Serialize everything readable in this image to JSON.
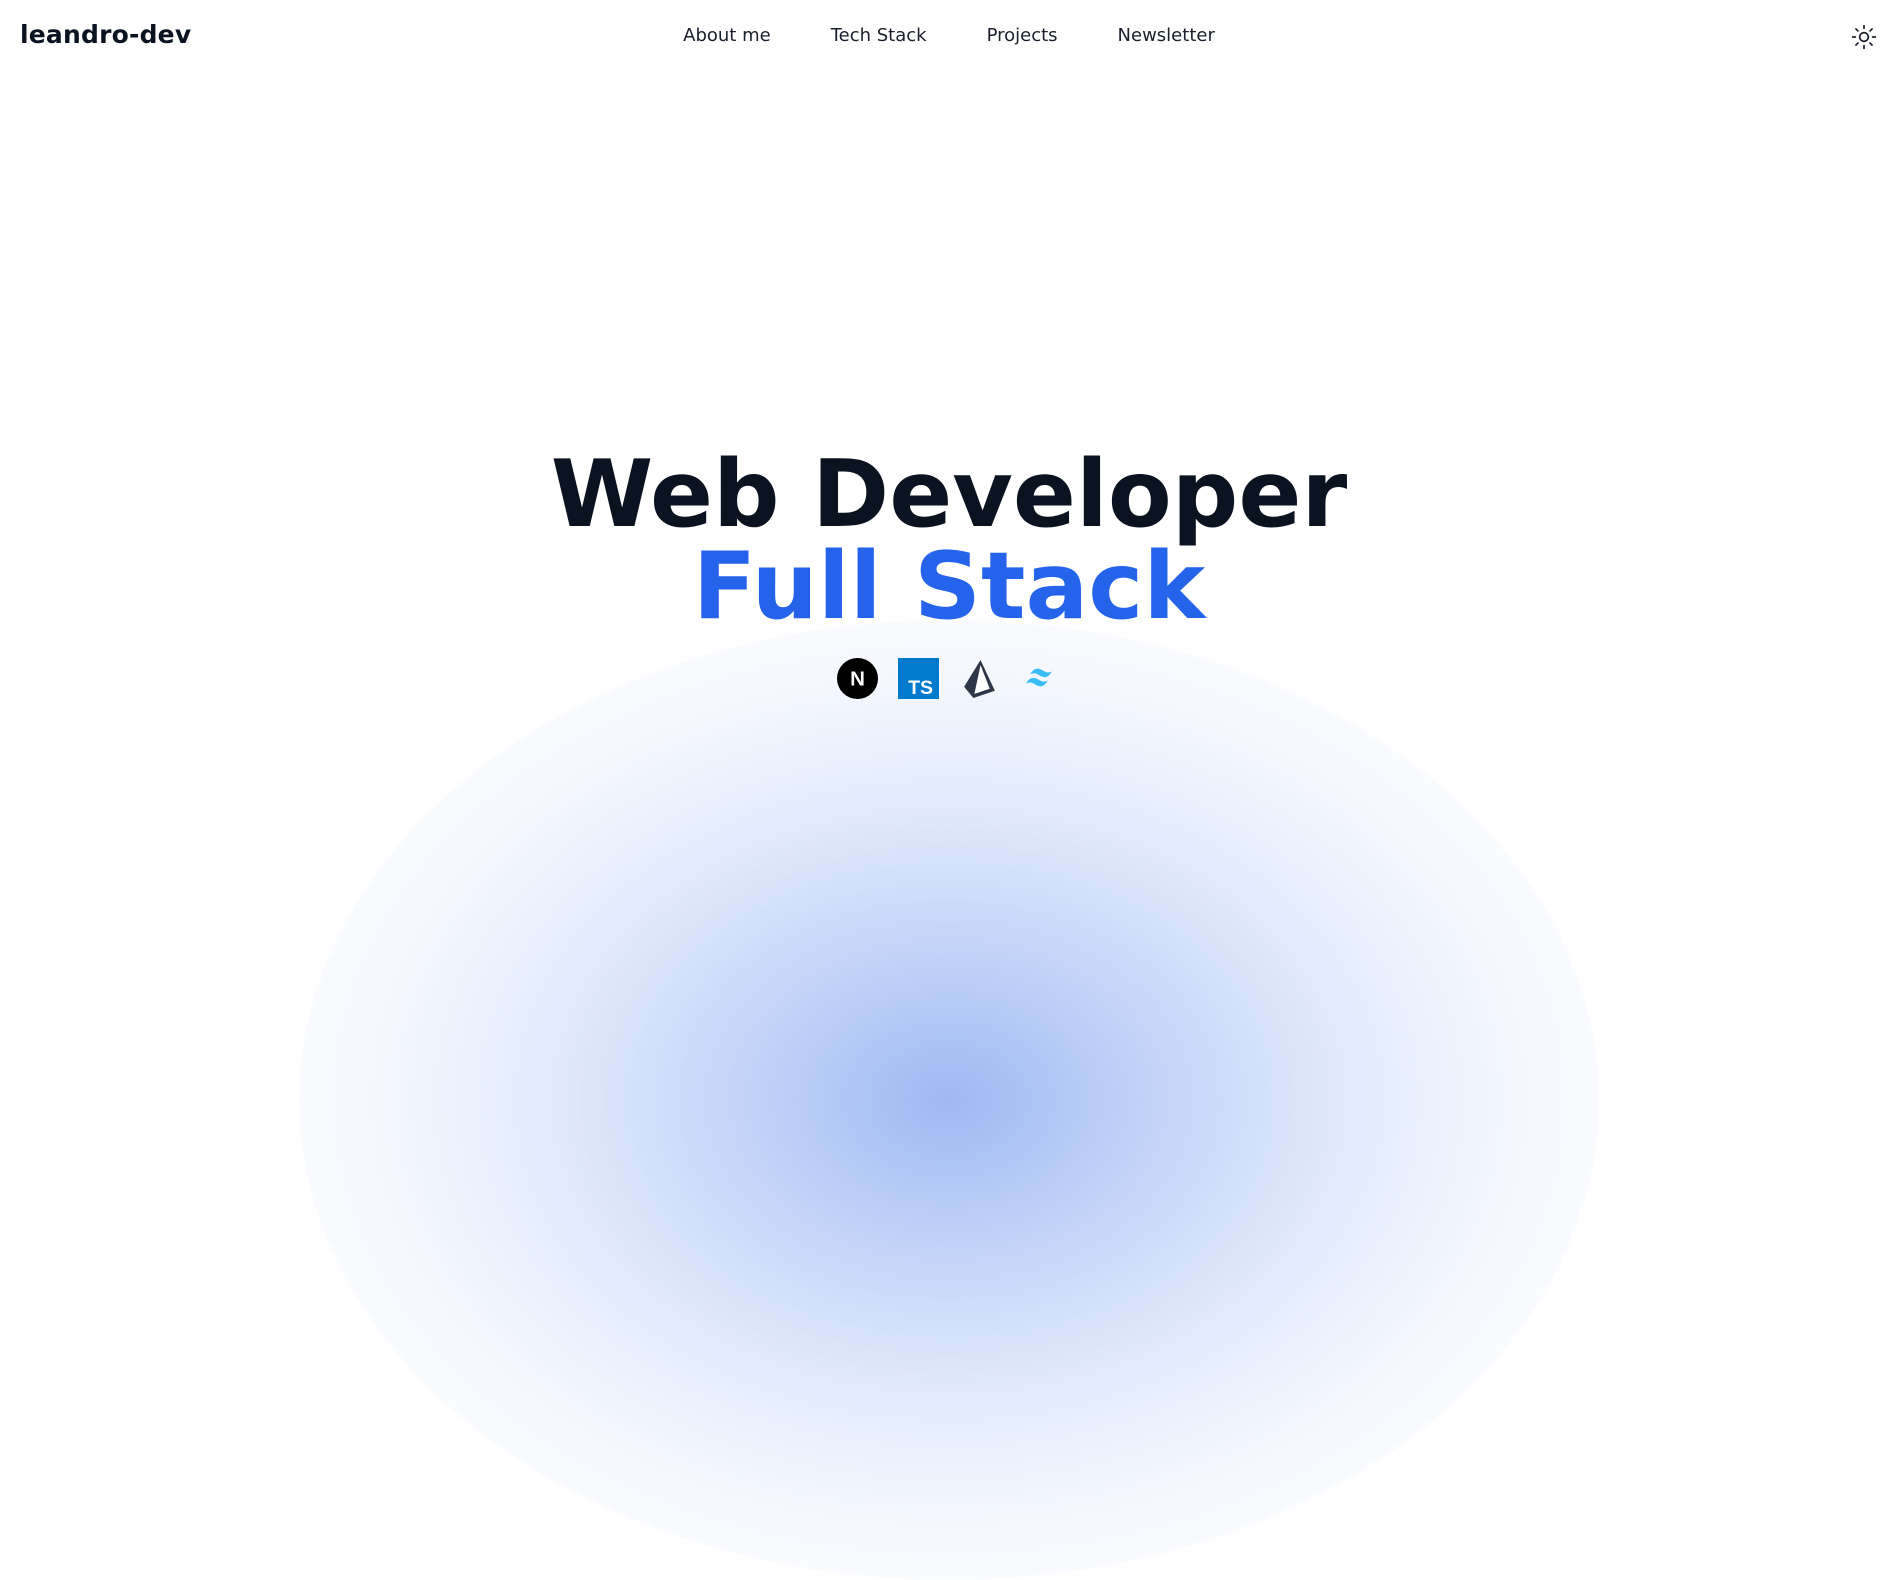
{
  "header": {
    "logo": "leandro-dev",
    "nav": [
      {
        "label": "About me"
      },
      {
        "label": "Tech Stack"
      },
      {
        "label": "Projects"
      },
      {
        "label": "Newsletter"
      }
    ],
    "theme_toggle_icon": "sun-icon"
  },
  "hero": {
    "title_line1": "Web Developer",
    "title_line2": "Full Stack",
    "tech_icons": [
      {
        "name": "nextjs-icon",
        "label": "N"
      },
      {
        "name": "typescript-icon",
        "label": "TS"
      },
      {
        "name": "prisma-icon"
      },
      {
        "name": "tailwind-icon"
      }
    ]
  },
  "colors": {
    "accent": "#2563eb",
    "text": "#0b1220",
    "typescript": "#007acc",
    "tailwind": "#38bdf8",
    "glow": "#8eacf1"
  }
}
